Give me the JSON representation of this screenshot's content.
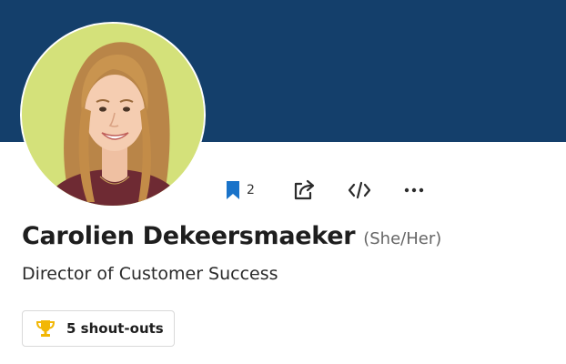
{
  "profile": {
    "name": "Carolien Dekeersmaeker",
    "pronouns": "(She/Her)",
    "job_title": "Director of Customer Success"
  },
  "actions": {
    "bookmark_count": "2",
    "icons": [
      "bookmark-icon",
      "share-icon",
      "embed-code-icon",
      "more-options-icon"
    ]
  },
  "shoutouts": {
    "label": "5 shout-outs",
    "icon": "trophy-icon"
  },
  "colors": {
    "banner": "#143f6b",
    "avatar_background": "#d4e17a",
    "bookmark_accent": "#1a73c9",
    "trophy": "#f2b705"
  }
}
